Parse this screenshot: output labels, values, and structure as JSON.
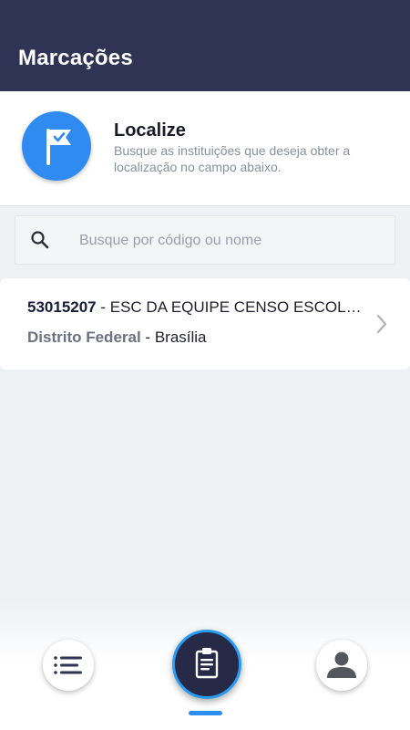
{
  "header": {
    "title": "Marcações"
  },
  "info": {
    "title": "Localize",
    "description": "Busque as instituições que deseja obter a localização no campo abaixo.",
    "icon": "flag-check-icon"
  },
  "search": {
    "placeholder": "Busque por código ou nome",
    "value": "",
    "icon": "search-icon"
  },
  "results": [
    {
      "code": "53015207",
      "separator1": " - ",
      "name": "ESC DA EQUIPE CENSO ESCOLAR",
      "state": "Distrito Federal",
      "separator2": " - ",
      "city": "Brasília"
    }
  ],
  "bottom_nav": {
    "items": [
      {
        "icon": "list-icon",
        "active": false
      },
      {
        "icon": "clipboard-icon",
        "active": true
      },
      {
        "icon": "profile-icon",
        "active": false
      }
    ]
  },
  "colors": {
    "header_bg": "#2f3354",
    "accent": "#2f8bf0",
    "nav_active": "#262a47"
  }
}
